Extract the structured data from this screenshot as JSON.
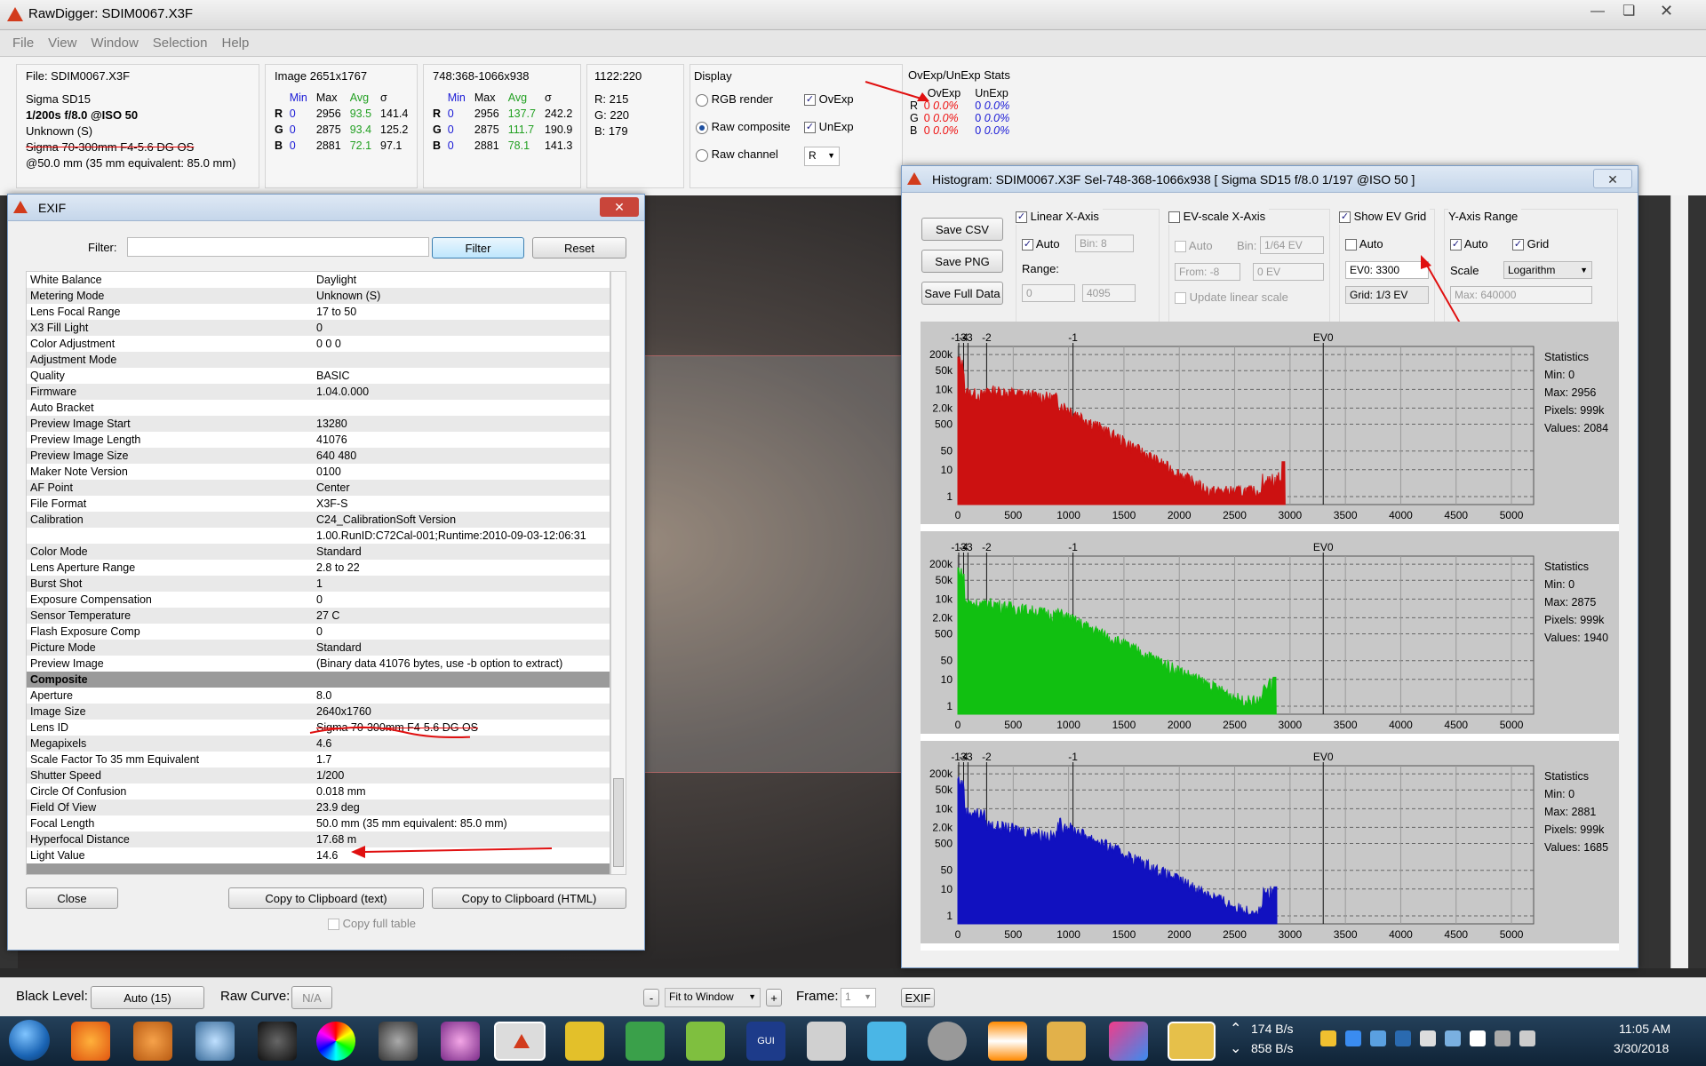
{
  "app": {
    "title": "RawDigger: SDIM0067.X3F",
    "menu": [
      "File",
      "View",
      "Window",
      "Selection",
      "Help"
    ]
  },
  "info": {
    "file": {
      "head": "File: SDIM0067.X3F",
      "camera": "Sigma SD15",
      "exposure": "1/200s f/8.0 @ISO 50",
      "mode": "Unknown (S)",
      "lens": "Sigma 70-300mm F4-5.6 DG OS",
      "focal": "@50.0 mm (35 mm equivalent: 85.0 mm)"
    },
    "image": {
      "head": "Image 2651x1767",
      "cols": [
        "Min",
        "Max",
        "Avg",
        "σ"
      ],
      "rows": [
        {
          "ch": "R",
          "min": "0",
          "max": "2956",
          "avg": "93.5",
          "sd": "141.4"
        },
        {
          "ch": "G",
          "min": "0",
          "max": "2875",
          "avg": "93.4",
          "sd": "125.2"
        },
        {
          "ch": "B",
          "min": "0",
          "max": "2881",
          "avg": "72.1",
          "sd": "97.1"
        }
      ]
    },
    "sel": {
      "head": "748:368-1066x938",
      "cols": [
        "Min",
        "Max",
        "Avg",
        "σ"
      ],
      "rows": [
        {
          "ch": "R",
          "min": "0",
          "max": "2956",
          "avg": "137.7",
          "sd": "242.2"
        },
        {
          "ch": "G",
          "min": "0",
          "max": "2875",
          "avg": "111.7",
          "sd": "190.9"
        },
        {
          "ch": "B",
          "min": "0",
          "max": "2881",
          "avg": "78.1",
          "sd": "141.3"
        }
      ]
    },
    "point": {
      "head": "1122:220",
      "r": "R:  215",
      "g": "G:  220",
      "b": "B:  179"
    },
    "display": {
      "head": "Display",
      "rgb": "RGB render",
      "raw_comp": "Raw composite",
      "raw_ch": "Raw channel",
      "ovexp": "OvExp",
      "unexp": "UnExp",
      "channel": "R"
    },
    "ovexp": {
      "head": "OvExp/UnExp Stats",
      "cols": [
        "OvExp",
        "UnExp"
      ],
      "rows": [
        {
          "ch": "R",
          "a": "0",
          "ap": "0.0%",
          "b": "0",
          "bp": "0.0%"
        },
        {
          "ch": "G",
          "a": "0",
          "ap": "0.0%",
          "b": "0",
          "bp": "0.0%"
        },
        {
          "ch": "B",
          "a": "0",
          "ap": "0.0%",
          "b": "0",
          "bp": "0.0%"
        }
      ]
    }
  },
  "exif": {
    "title": "EXIF",
    "filter_label": "Filter:",
    "filter_btn": "Filter",
    "reset_btn": "Reset",
    "rows": [
      [
        "White Balance",
        "Daylight"
      ],
      [
        "Metering Mode",
        "Unknown (S)"
      ],
      [
        "Lens Focal Range",
        "17 to 50"
      ],
      [
        "X3 Fill Light",
        "0"
      ],
      [
        "Color Adjustment",
        "0 0 0"
      ],
      [
        "Adjustment Mode",
        ""
      ],
      [
        "Quality",
        "BASIC"
      ],
      [
        "Firmware",
        "1.04.0.000"
      ],
      [
        "Auto Bracket",
        ""
      ],
      [
        "Preview Image Start",
        "13280"
      ],
      [
        "Preview Image Length",
        "41076"
      ],
      [
        "Preview Image Size",
        "640 480"
      ],
      [
        "Maker Note Version",
        "0100"
      ],
      [
        "AF Point",
        "Center"
      ],
      [
        "File Format",
        "X3F-S"
      ],
      [
        "Calibration",
        "C24_CalibrationSoft Version"
      ],
      [
        "",
        "1.00.RunID:C72Cal-001;Runtime:2010-09-03-12:06:31"
      ],
      [
        "Color Mode",
        "Standard"
      ],
      [
        "Lens Aperture Range",
        "2.8 to 22"
      ],
      [
        "Burst Shot",
        "1"
      ],
      [
        "Exposure Compensation",
        "0"
      ],
      [
        "Sensor Temperature",
        "27 C"
      ],
      [
        "Flash Exposure Comp",
        "0"
      ],
      [
        "Picture Mode",
        "Standard"
      ],
      [
        "Preview Image",
        "(Binary data 41076 bytes, use -b option to extract)"
      ],
      [
        "Composite",
        ""
      ],
      [
        "Aperture",
        "8.0"
      ],
      [
        "Image Size",
        "2640x1760"
      ],
      [
        "Lens ID",
        "Sigma 70-300mm F4-5.6 DG OS"
      ],
      [
        "Megapixels",
        "4.6"
      ],
      [
        "Scale Factor To 35 mm Equivalent",
        "1.7"
      ],
      [
        "Shutter Speed",
        "1/200"
      ],
      [
        "Circle Of Confusion",
        "0.018 mm"
      ],
      [
        "Field Of View",
        "23.9 deg"
      ],
      [
        "Focal Length",
        "50.0 mm (35 mm equivalent: 85.0 mm)"
      ],
      [
        "Hyperfocal Distance",
        "17.68 m"
      ],
      [
        "Light Value",
        "14.6"
      ]
    ],
    "close_btn": "Close",
    "copy_text": "Copy to Clipboard (text)",
    "copy_html": "Copy to Clipboard (HTML)",
    "copy_full": "Copy full table"
  },
  "hist": {
    "title": "Histogram: SDIM0067.X3F Sel-748-368-1066x938 [ Sigma SD15 f/8.0 1/197 @ISO 50 ]",
    "save_csv": "Save CSV",
    "save_png": "Save PNG",
    "save_full": "Save Full Data",
    "linear_x": "Linear X-Axis",
    "auto": "Auto",
    "bin": "Bin: 8",
    "range": "Range:",
    "range_from": "0",
    "range_to": "4095",
    "evscale": "EV-scale X-Axis",
    "ev_auto": "Auto",
    "ev_bin_label": "Bin:",
    "ev_bin": "1/64 EV",
    "from": "From: -8",
    "to": "0 EV",
    "update": "Update linear scale",
    "show_ev": "Show EV Grid",
    "ev_grid_auto": "Auto",
    "ev0": "EV0: 3300",
    "grid": "Grid: 1/3 EV",
    "yrange": "Y-Axis Range",
    "y_auto": "Auto",
    "y_grid": "Grid",
    "scale_label": "Scale",
    "scale": "Logarithm",
    "max": "Max: 640000",
    "ev_ticks": [
      "-13",
      "-4",
      "-3",
      "-2",
      "-1",
      "EV0"
    ],
    "y_ticks": [
      "200k",
      "50k",
      "10k",
      "2.0k",
      "500",
      "50",
      "10",
      "1"
    ],
    "x_ticks": [
      "0",
      "500",
      "1000",
      "1500",
      "2000",
      "2500",
      "3000",
      "3500",
      "4000",
      "4500",
      "5000"
    ],
    "panels": [
      {
        "color": "#cc1111",
        "stats": {
          "title": "Statistics",
          "min": "Min: 0",
          "max": "Max: 2956",
          "pixels": "Pixels: 999k",
          "values": "Values: 2084"
        }
      },
      {
        "color": "#11c011",
        "stats": {
          "title": "Statistics",
          "min": "Min: 0",
          "max": "Max: 2875",
          "pixels": "Pixels: 999k",
          "values": "Values: 1940"
        }
      },
      {
        "color": "#1111c0",
        "stats": {
          "title": "Statistics",
          "min": "Min: 0",
          "max": "Max: 2881",
          "pixels": "Pixels: 999k",
          "values": "Values: 1685"
        }
      }
    ]
  },
  "status": {
    "black_level": "Black Level:",
    "black_val": "Auto (15)",
    "raw_curve": "Raw Curve:",
    "raw_val": "N/A",
    "minus": "-",
    "fit": "Fit to Window",
    "plus": "+",
    "frame": "Frame:",
    "frame_val": "1",
    "exif": "EXIF"
  },
  "taskbar": {
    "net_up": "174 B/s",
    "net_down": "858 B/s",
    "time": "11:05 AM",
    "date": "3/30/2018"
  }
}
